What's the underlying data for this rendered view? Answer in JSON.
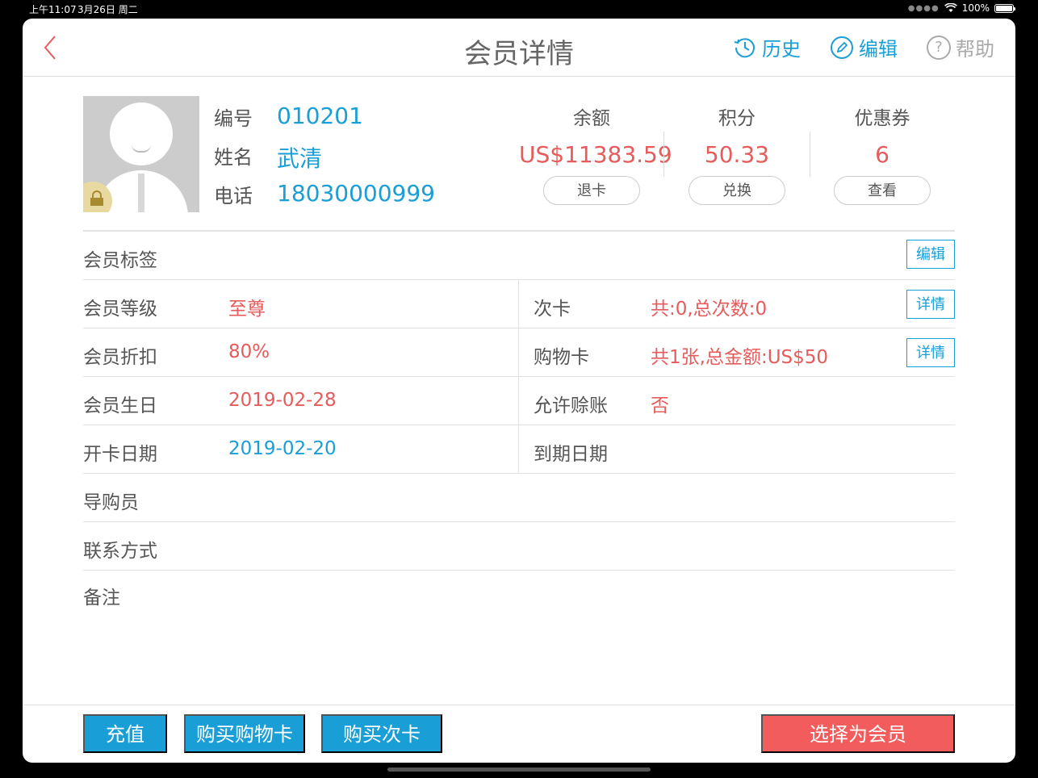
{
  "status_bar": {
    "time": "上午11:07",
    "date": "3月26日 周二",
    "battery": "100%"
  },
  "nav": {
    "title": "会员详情",
    "history": "历史",
    "edit": "编辑",
    "help": "帮助"
  },
  "member": {
    "id_label": "编号",
    "id": "010201",
    "name_label": "姓名",
    "name": "武清",
    "phone_label": "电话",
    "phone": "18030000999"
  },
  "stats": [
    {
      "title": "余额",
      "value": "US$11383.59",
      "button": "退卡"
    },
    {
      "title": "积分",
      "value": "50.33",
      "button": "兑换"
    },
    {
      "title": "优惠券",
      "value": "6",
      "button": "查看"
    }
  ],
  "tags": {
    "label": "会员标签",
    "button": "编辑"
  },
  "rows": [
    {
      "label": "会员等级",
      "value": "至尊",
      "right_label": "次卡",
      "right_value": "共:0,总次数:0",
      "button": "详情"
    },
    {
      "label": "会员折扣",
      "value": "80%",
      "right_label": "购物卡",
      "right_value": "共1张,总金额:US$50",
      "button": "详情"
    },
    {
      "label": "会员生日",
      "value": "2019-02-28",
      "right_label": "允许赊账",
      "right_value": "否"
    },
    {
      "label": "开卡日期",
      "value": "2019-02-20",
      "right_label": "到期日期",
      "right_value": ""
    }
  ],
  "single_rows": [
    {
      "label": "导购员"
    },
    {
      "label": "联系方式"
    },
    {
      "label": "备注"
    }
  ],
  "footer": {
    "recharge": "充值",
    "buy_shopping_card": "购买购物卡",
    "buy_times_card": "购买次卡",
    "select_member": "选择为会员"
  },
  "colors": {
    "accent": "#1a9ed6",
    "highlight": "#e65b5b",
    "primary_action": "#f25c5c"
  }
}
